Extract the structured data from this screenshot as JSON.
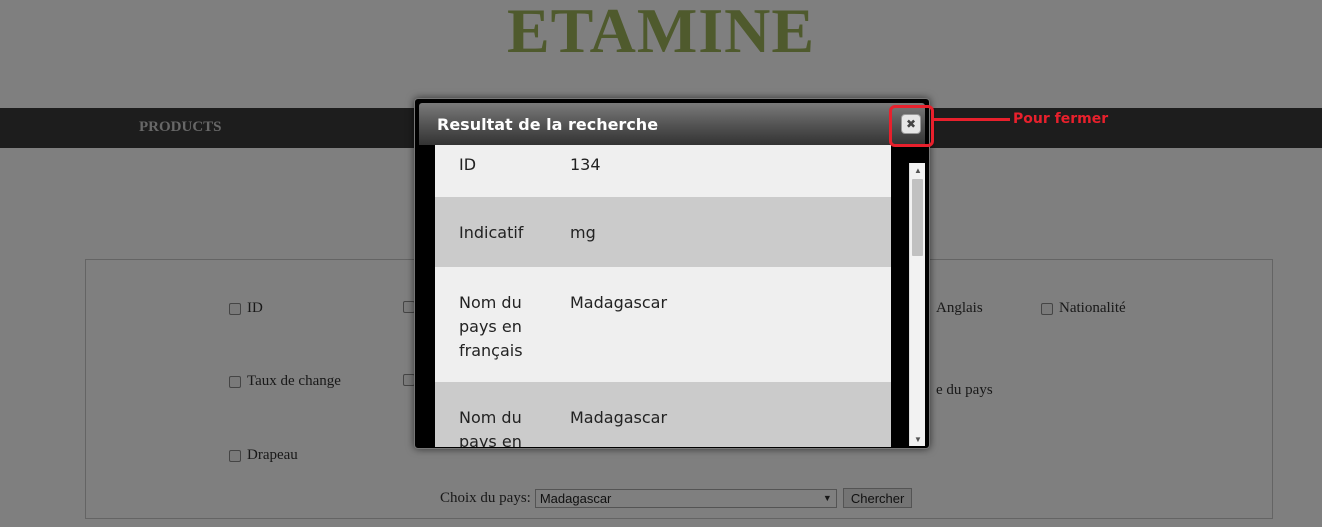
{
  "site": {
    "title": "ETAMINE"
  },
  "nav": {
    "items": [
      {
        "label": "PRODUCTS"
      }
    ]
  },
  "form": {
    "fields": [
      {
        "label": "ID",
        "checked": false
      },
      {
        "label": "Anglais",
        "checked": false
      },
      {
        "label": "Nationalité",
        "checked": false
      },
      {
        "label": "Taux de change",
        "checked": false
      },
      {
        "label": "e du pays",
        "checked": false
      },
      {
        "label": "Drapeau",
        "checked": false
      }
    ],
    "country_label": "Choix du pays:",
    "country_selected": "Madagascar",
    "search_button": "Chercher"
  },
  "modal": {
    "title": "Resultat de la recherche",
    "close_icon": "close-x",
    "rows": [
      {
        "label": "ID",
        "value": "134"
      },
      {
        "label": "Indicatif",
        "value": "mg"
      },
      {
        "label": "Nom du pays en français",
        "value": "Madagascar"
      },
      {
        "label": "Nom du pays en",
        "value": "Madagascar"
      }
    ]
  },
  "annotation": {
    "text": "Pour fermer",
    "color": "#e8202c"
  }
}
